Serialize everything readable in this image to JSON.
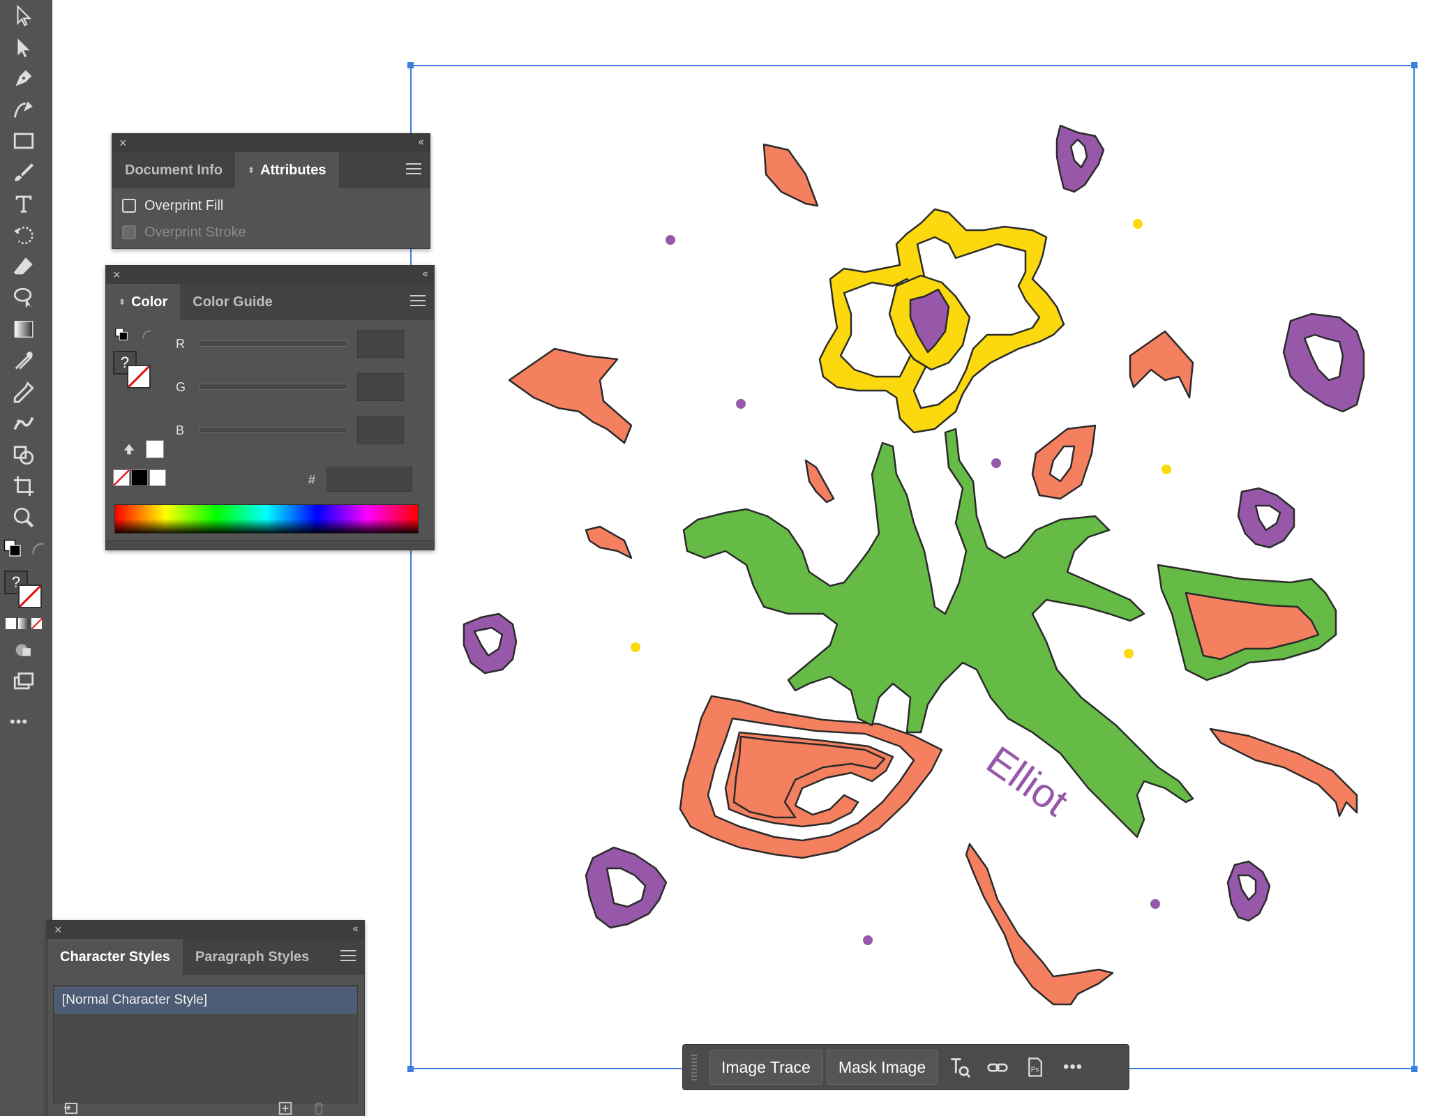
{
  "attributes_panel": {
    "tabs": [
      "Document Info",
      "Attributes"
    ],
    "active_tab": "Attributes",
    "overprint_fill": "Overprint Fill",
    "overprint_stroke": "Overprint Stroke"
  },
  "color_panel": {
    "tabs": [
      "Color",
      "Color Guide"
    ],
    "active_tab": "Color",
    "channels": [
      "R",
      "G",
      "B"
    ],
    "hex_label": "#",
    "unknown_fill": "?"
  },
  "styles_panel": {
    "tabs": [
      "Character Styles",
      "Paragraph Styles"
    ],
    "active_tab": "Character Styles",
    "items": [
      "[Normal Character Style]"
    ]
  },
  "context_bar": {
    "image_trace": "Image Trace",
    "mask_image": "Mask Image",
    "more": "•••"
  },
  "toolbar": {
    "more": "•••",
    "unknown_fill": "?"
  },
  "artwork": {
    "signature": "Elliot",
    "colors": {
      "orange": "#f58060",
      "green": "#65bb45",
      "yellow": "#fcd80f",
      "purple": "#9758a9"
    }
  }
}
